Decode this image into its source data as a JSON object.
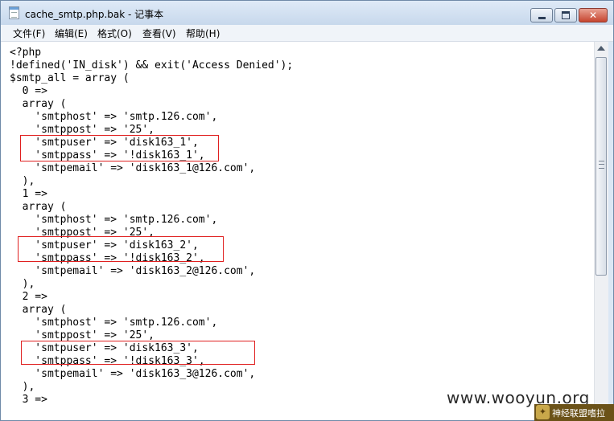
{
  "window": {
    "title": "cache_smtp.php.bak - 记事本"
  },
  "menu": [
    {
      "label": "文件(F)"
    },
    {
      "label": "编辑(E)"
    },
    {
      "label": "格式(O)"
    },
    {
      "label": "查看(V)"
    },
    {
      "label": "帮助(H)"
    }
  ],
  "editor": {
    "content": "<?php\n!defined('IN_disk') && exit('Access Denied');\n$smtp_all = array (\n  0 =>\n  array (\n    'smtphost' => 'smtp.126.com',\n    'smtppost' => '25',\n    'smtpuser' => 'disk163_1',\n    'smtppass' => '!disk163_1',\n    'smtpemail' => 'disk163_1@126.com',\n  ),\n  1 =>\n  array (\n    'smtphost' => 'smtp.126.com',\n    'smtppost' => '25',\n    'smtpuser' => 'disk163_2',\n    'smtppass' => '!disk163_2',\n    'smtpemail' => 'disk163_2@126.com',\n  ),\n  2 =>\n  array (\n    'smtphost' => 'smtp.126.com',\n    'smtppost' => '25',\n    'smtpuser' => 'disk163_3',\n    'smtppass' => '!disk163_3',\n    'smtpemail' => 'disk163_3@126.com',\n  ),\n  3 =>"
  },
  "watermark": {
    "site": "www.wooyun.org",
    "brand": "神经联盟嗜拉"
  },
  "colors": {
    "highlight_box": "#e02020",
    "close_button": "#c6452f"
  }
}
